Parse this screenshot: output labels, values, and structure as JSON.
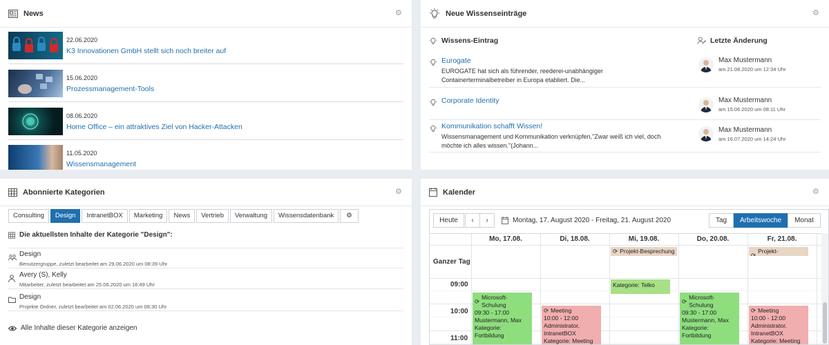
{
  "news": {
    "title": "News",
    "items": [
      {
        "date": "22.06.2020",
        "title": "K3 Innovationen GmbH stellt sich noch breiter auf"
      },
      {
        "date": "15.06.2020",
        "title": "Prozessmanagement-Tools"
      },
      {
        "date": "08.06.2020",
        "title": "Home Office – ein attraktives Ziel von Hacker-Attacken"
      },
      {
        "date": "11.05.2020",
        "title": "Wissensmanagement"
      }
    ]
  },
  "wiki": {
    "title": "Neue Wissenseinträge",
    "col_entry": "Wissens-Eintrag",
    "col_changed": "Letzte Änderung",
    "rows": [
      {
        "title": "Eurogate",
        "desc": "EUROGATE hat sich als führender, reederei-unabhängiger Containerterminalbetreiber in Europa etabliert. Die...",
        "user": "Max Mustermann",
        "date": "am 21.08.2020 um 12:34 Uhr"
      },
      {
        "title": "Corporate Identity",
        "desc": "",
        "user": "Max Mustermann",
        "date": "am 15.06.2020 um 08:11 Uhr"
      },
      {
        "title": "Kommunikation schafft Wissen!",
        "desc": "Wissensmanagement und Kommunikation verknüpfen,\"Zwar weiß ich viel, doch möchte ich alles wissen.\"(Johann...",
        "user": "Max Mustermann",
        "date": "am 16.07.2020 um 14:24 Uhr"
      }
    ]
  },
  "abo": {
    "title": "Abonnierte Kategorien",
    "tabs": [
      "Consulting",
      "Design",
      "IntranetBOX",
      "Marketing",
      "News",
      "Vertrieb",
      "Verwaltung",
      "Wissensdatenbank"
    ],
    "active_tab": "Design",
    "heading": "Die aktuellsten Inhalte der Kategorie \"Design\":",
    "rows": [
      {
        "icon": "group-icon",
        "name": "Design",
        "sub": "Benutzergruppe, zuletzt bearbeitet am 29.06.2020 um 08:39 Uhr"
      },
      {
        "icon": "user-icon",
        "name": "Avery (S), Kelly",
        "sub": "Mitarbeiter, zuletzt bearbeitet am 25.06.2020 um 16:49 Uhr"
      },
      {
        "icon": "folder-icon",
        "name": "Design",
        "sub": "Projekte Ordner, zuletzt bearbeitet am 02.06.2020 um 08:30 Uhr"
      }
    ],
    "show_all": "Alle Inhalte dieser Kategorie anzeigen"
  },
  "calendar": {
    "title": "Kalender",
    "today": "Heute",
    "range": "Montag, 17. August 2020 - Freitag, 21. August 2020",
    "views": [
      "Tag",
      "Arbeitswoche",
      "Monat"
    ],
    "active_view": "Arbeitswoche",
    "days": [
      "Mo, 17.08.",
      "Di, 18.08.",
      "Mi, 19.08.",
      "Do, 20.08.",
      "Fr, 21.08."
    ],
    "allday_label": "Ganzer Tag",
    "times": [
      "09:00",
      "10:00",
      "11:00"
    ],
    "allday_events": [
      {
        "day": 2,
        "title": "Projekt-Besprechung"
      },
      {
        "day": 4,
        "title": "Projekt-Besprechung"
      }
    ],
    "events": [
      {
        "day": 2,
        "title": "",
        "lines": [
          "Kategorie: Telko"
        ],
        "color": "lgreen"
      },
      {
        "day": 0,
        "title": "Microsoft-Schulung",
        "lines": [
          "09:30 - 17:00",
          "Mustermann, Max",
          "Kategorie: Fortbildung"
        ],
        "color": "green"
      },
      {
        "day": 3,
        "title": "Microsoft-Schulung",
        "lines": [
          "09:30 - 17:00",
          "Mustermann, Max",
          "Kategorie: Fortbildung"
        ],
        "color": "green"
      },
      {
        "day": 1,
        "title": "Meeting",
        "lines": [
          "10:00 - 12:00",
          "Administrator, IntranetBOX",
          "Kategorie: Meeting"
        ],
        "color": "red"
      },
      {
        "day": 4,
        "title": "Meeting",
        "lines": [
          "10:00 - 12:00",
          "Administrator, IntranetBOX",
          "Kategorie: Meeting"
        ],
        "color": "red"
      }
    ]
  }
}
